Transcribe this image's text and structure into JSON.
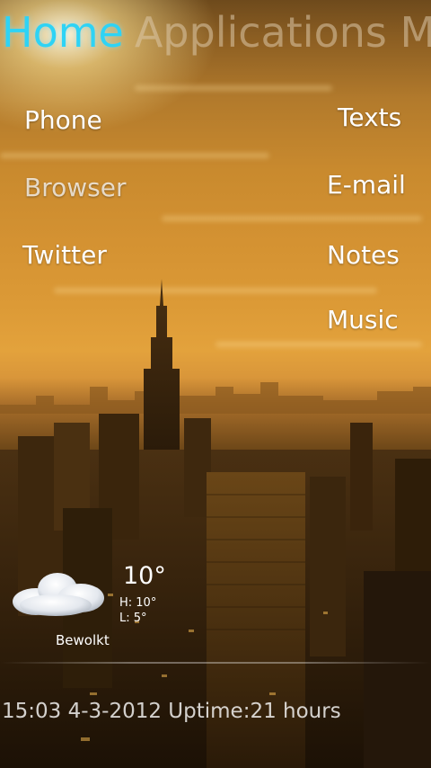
{
  "header": {
    "tabs": [
      {
        "label": "Home"
      },
      {
        "label": "Applications M"
      }
    ]
  },
  "shortcuts": {
    "left": [
      "Phone",
      "Browser",
      "Twitter"
    ],
    "right": [
      "Texts",
      "E-mail",
      "Notes",
      "Music"
    ]
  },
  "weather": {
    "icon": "cloud-icon",
    "temperature": "10°",
    "high": "H: 10°",
    "low": "L: 5°",
    "condition": "Bewolkt"
  },
  "status": {
    "text": "15:03 4-3-2012 Uptime:21 hours"
  },
  "colors": {
    "active_tab": "#2ed3f5",
    "inactive_tab": "#dcc8aa",
    "text": "#ffffff",
    "sky": "#dc9a36"
  }
}
